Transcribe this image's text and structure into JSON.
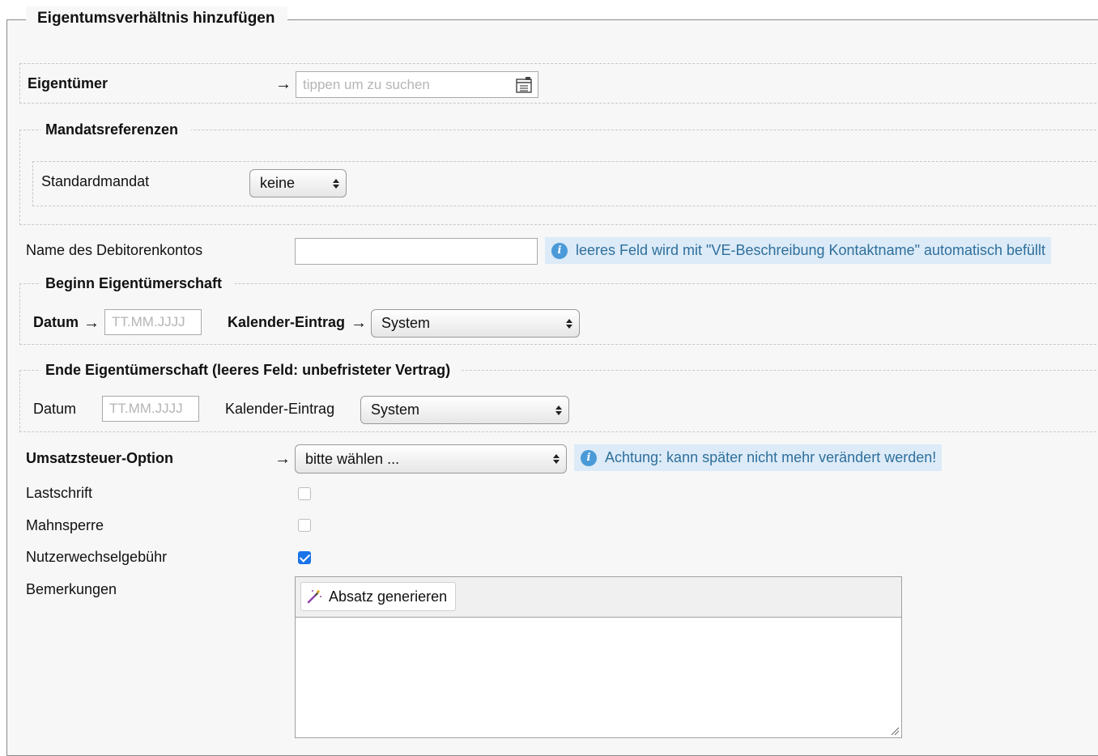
{
  "form": {
    "title": "Eigentumsverhältnis hinzufügen",
    "arrow": "→",
    "owner": {
      "label": "Eigentümer",
      "placeholder": "tippen um zu suchen",
      "value": ""
    },
    "mandates": {
      "legend": "Mandatsreferenzen",
      "default_label": "Standardmandat",
      "default_value": "keine"
    },
    "debtor": {
      "label": "Name des Debitorenkontos",
      "value": "",
      "info": "leeres Feld wird mit \"VE-Beschreibung Kontaktname\" automatisch befüllt"
    },
    "begin": {
      "legend": "Beginn Eigentümerschaft",
      "date_label": "Datum",
      "date_placeholder": "TT.MM.JJJJ",
      "calendar_label": "Kalender-Eintrag",
      "calendar_value": "System"
    },
    "end": {
      "legend": "Ende Eigentümerschaft (leeres Feld: unbefristeter Vertrag)",
      "date_label": "Datum",
      "date_placeholder": "TT.MM.JJJJ",
      "calendar_label": "Kalender-Eintrag",
      "calendar_value": "System"
    },
    "vat": {
      "label": "Umsatzsteuer-Option",
      "value": "bitte wählen ...",
      "info": "Achtung: kann später nicht mehr verändert werden!"
    },
    "direct_debit": {
      "label": "Lastschrift",
      "checked": false
    },
    "dunning_block": {
      "label": "Mahnsperre",
      "checked": false
    },
    "user_change_fee": {
      "label": "Nutzerwechselgebühr",
      "checked": true
    },
    "remarks": {
      "label": "Bemerkungen",
      "toolbar_button": "Absatz generieren",
      "value": ""
    }
  },
  "colors": {
    "info_bg": "#dcebf7",
    "info_text": "#2f6f9c",
    "checkbox_checked": "#1a73e8"
  },
  "icons": {
    "owner_search": "list-picker-icon",
    "info": "info-icon",
    "magic": "magic-wand-icon"
  }
}
